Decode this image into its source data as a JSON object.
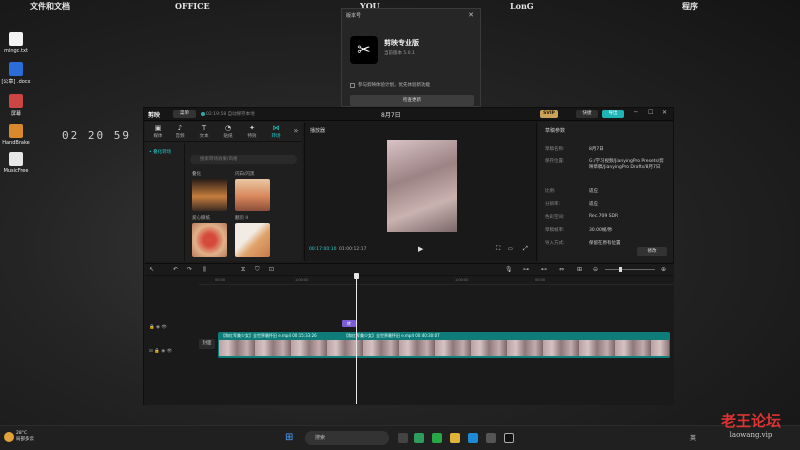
{
  "desktop_bar": [
    "文件和文档",
    "OFFICE",
    "YOU",
    "LonG",
    "程序"
  ],
  "desktop_icons": [
    {
      "label": "mingc.txt",
      "icon": "text-file-icon"
    },
    {
      "label": "[公章]\n.docx",
      "icon": "word-doc-icon"
    },
    {
      "label": "屏幕",
      "icon": "image-file-icon"
    },
    {
      "label": "HandBrake",
      "icon": "handbrake-icon"
    },
    {
      "label": "MusicFree",
      "icon": "music-app-icon"
    }
  ],
  "clock": "02 20 59",
  "about": {
    "title": "版本号",
    "app_name": "剪映专业版",
    "version": "当前版本 5.0.1",
    "checkbox_label": "参与剪映体验计划，优先体验新功能",
    "button": "检查更新"
  },
  "editor": {
    "logo": "剪映",
    "menu_label": "菜单",
    "autosave": "02:19:58 自动保存本地",
    "project_name": "8月7日",
    "vip_badge": "SVIP",
    "share_label": "快捷",
    "export_label": "导出",
    "window_buttons": [
      "─",
      "☐",
      "✕"
    ]
  },
  "media": {
    "tabs": [
      {
        "label": "媒体",
        "icon": "▣"
      },
      {
        "label": "音频",
        "icon": "♪"
      },
      {
        "label": "文本",
        "icon": "T"
      },
      {
        "label": "贴纸",
        "icon": "◔"
      },
      {
        "label": "特效",
        "icon": "✦"
      },
      {
        "label": "转场",
        "icon": "⋈"
      }
    ],
    "active_tab": 5,
    "sidebar_item": "• 叠化转场",
    "search_placeholder": "搜索转场效果/风格",
    "thumbs": [
      {
        "label": "叠化"
      },
      {
        "label": "闪白/闪黑"
      },
      {
        "label": "爱心撕纸"
      },
      {
        "label": "翻页 II"
      }
    ]
  },
  "player": {
    "title": "播放器",
    "current_time": "00:17:00:10",
    "duration": "01:00:12:17",
    "play_icon": "▶"
  },
  "props": {
    "title": "草稿参数",
    "rows": [
      {
        "k": "草稿名称:",
        "v": "8月7日"
      },
      {
        "k": "保存位置:",
        "v": "G:/学习视频/JianyingPro Presets/剪映草稿/JianyingPro Drafts/8月7日"
      },
      {
        "k": "比例:",
        "v": "适应"
      },
      {
        "k": "分辨率:",
        "v": "适应"
      },
      {
        "k": "色彩空间:",
        "v": "Rec.709 SDR"
      },
      {
        "k": "草稿帧率:",
        "v": "30.00帧/秒"
      },
      {
        "k": "导入方式:",
        "v": "保留在原有位置"
      }
    ],
    "button": "修改"
  },
  "timeline": {
    "ticks": [
      "00:00",
      "1:00:00",
      "",
      "1:00:00",
      "00:00",
      "",
      ""
    ],
    "cover_label": "封面",
    "text_clip": "转",
    "clip_titles": [
      "【和红军美少女】全世界最怀旧 e.mp4  00:15:33:26",
      "【和红军美少女】全世界最怀旧 e.mp4  00:40:30:07"
    ]
  },
  "taskbar": {
    "weather_temp": "28°C",
    "weather_desc": "局部多云",
    "search_placeholder": "搜索",
    "tray": "英"
  },
  "watermark": {
    "title": "老王论坛",
    "sub": "laowang.vip"
  }
}
